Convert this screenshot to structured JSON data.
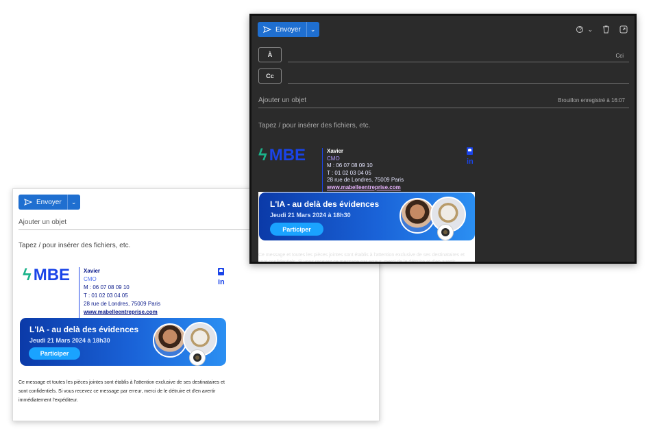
{
  "compose": {
    "send_label": "Envoyer",
    "to_label": "À",
    "cc_label": "Cc",
    "bcc_label": "Cci",
    "subject_placeholder": "Ajouter un objet",
    "body_placeholder": "Tapez / pour insérer des fichiers, etc.",
    "draft_status": "Brouillon enregistré à 16:07"
  },
  "signature": {
    "logo_text": "MBE",
    "name": "Xavier",
    "title": "CMO",
    "mobile": "M : 06 07 08 09 10",
    "phone": "T : 01 02 03 04 05",
    "address": "28 rue de Londres, 75009 Paris",
    "website": "www.mabelleentreprise.com",
    "linkedin": "in"
  },
  "banner": {
    "title": "L'IA - au delà des évidences",
    "date": "Jeudi 21 Mars 2024 à 18h30",
    "cta": "Participer"
  },
  "disclaimer": {
    "line1": "Ce message et toutes les pièces jointes sont établis à l'attention exclusive de ses destinataires et",
    "line2": "sont confidentiels. Si vous recevez ce message par erreur, merci de le détruire et d'en avertir",
    "line3": "immédiatement l'expéditeur."
  },
  "icons": [
    "send-icon",
    "chevron-down-icon",
    "help-icon",
    "trash-icon",
    "popout-icon",
    "contact-card-icon",
    "linkedin-icon"
  ],
  "colors": {
    "accent": "#1f6fd0",
    "brand": "#1a44e8",
    "dark_bg": "#2b2b2b"
  }
}
